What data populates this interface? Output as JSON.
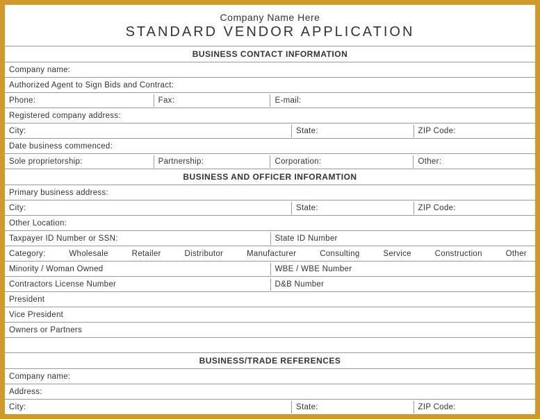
{
  "header": {
    "company_line": "Company Name Here",
    "title": "STANDARD VENDOR APPLICATION"
  },
  "sections": {
    "contact": {
      "heading": "BUSINESS CONTACT INFORMATION",
      "company_name": "Company name:",
      "authorized_agent": "Authorized Agent to Sign Bids and Contract:",
      "phone": "Phone:",
      "fax": "Fax:",
      "email": "E-mail:",
      "registered_address": "Registered company address:",
      "city": "City:",
      "state": "State:",
      "zip": "ZIP Code:",
      "date_commenced": "Date business commenced:",
      "sole_prop": "Sole proprietorship:",
      "partnership": "Partnership:",
      "corporation": "Corporation:",
      "other": "Other:"
    },
    "officer": {
      "heading": "BUSINESS AND OFFICER INFORAMTION",
      "primary_address": "Primary business address:",
      "city": "City:",
      "state": "State:",
      "zip": "ZIP Code:",
      "other_location": "Other Location:",
      "taxpayer_id": "Taxpayer ID Number or SSN:",
      "state_id": "State ID Number",
      "category_label": "Category:",
      "categories": [
        "Wholesale",
        "Retailer",
        "Distributor",
        "Manufacturer",
        "Consulting",
        "Service",
        "Construction",
        "Other"
      ],
      "minority": "Minority / Woman Owned",
      "wbe": "WBE / WBE Number",
      "contractors_license": "Contractors License Number",
      "db_number": "D&B Number",
      "president": "President",
      "vice_president": "Vice President",
      "owners_partners": "Owners or Partners"
    },
    "references": {
      "heading": "BUSINESS/TRADE REFERENCES",
      "company_name": "Company name:",
      "address": "Address:",
      "city": "City:",
      "state": "State:",
      "zip": "ZIP Code:"
    }
  }
}
